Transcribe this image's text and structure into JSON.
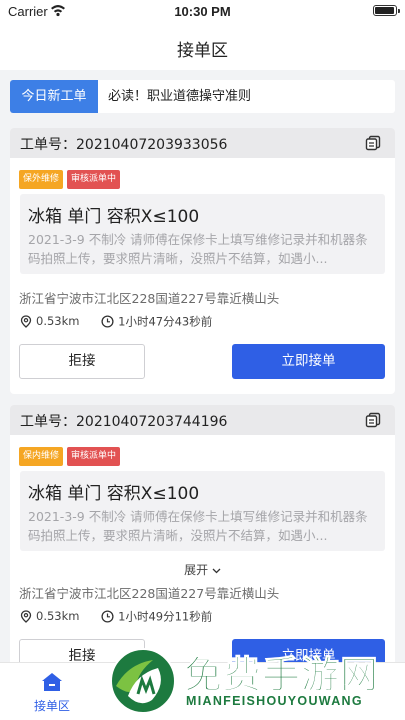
{
  "status_bar": {
    "carrier": "Carrier",
    "time": "10:30 PM"
  },
  "nav": {
    "title": "接单区"
  },
  "notice": {
    "tag": "今日新工单",
    "text": "必读！职业道德操守准则"
  },
  "orders": [
    {
      "order_label": "工单号：",
      "order_no": "20210407203933056",
      "badges": [
        "保外维修",
        "审核派单中"
      ],
      "title": "冰箱  单门 容积X≤100",
      "description": "2021-3-9 不制冷 请师傅在保修卡上填写维修记录并和机器条码拍照上传，要求照片清晰，没照片不结算，如遇小...",
      "address": "浙江省宁波市江北区228国道227号靠近横山头",
      "distance": "0.53km",
      "elapsed": "1小时47分43秒前",
      "reject_label": "拒接",
      "accept_label": "立即接单"
    },
    {
      "order_label": "工单号：",
      "order_no": "20210407203744196",
      "badges": [
        "保内维修",
        "审核派单中"
      ],
      "title": "冰箱  单门 容积X≤100",
      "description": "2021-3-9 不制冷 请师傅在保修卡上填写维修记录并和机器条码拍照上传，要求照片清晰，没照片不结算，如遇小...",
      "expand_label": "展开",
      "address": "浙江省宁波市江北区228国道227号靠近横山头",
      "distance": "0.53km",
      "elapsed": "1小时49分11秒前",
      "reject_label": "拒接",
      "accept_label": "立即接单"
    }
  ],
  "tabbar": {
    "tabs": [
      {
        "label": "接单区",
        "icon": "home-icon",
        "active": true
      }
    ]
  },
  "watermark": {
    "cn": "免费手游网",
    "en": "MIANFEISHOUYOUWANG"
  },
  "colors": {
    "primary": "#2f5fe5",
    "notice_tag": "#3d7fe6",
    "badge_orange": "#f5a623",
    "badge_red": "#e25252",
    "watermark": "#1d7a3f"
  }
}
